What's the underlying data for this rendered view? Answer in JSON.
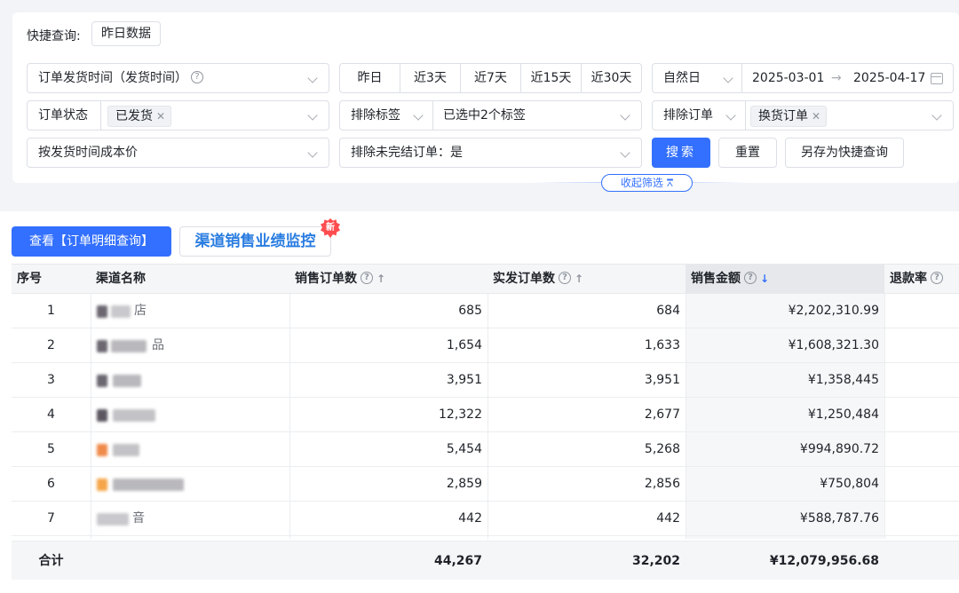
{
  "quick_query": {
    "label": "快捷查询:",
    "tag": "昨日数据"
  },
  "filters": {
    "time_field": "订单发货时间（发货时间）",
    "date_presets": [
      "昨日",
      "近3天",
      "近7天",
      "近15天",
      "近30天"
    ],
    "day_type": "自然日",
    "date_start": "2025-03-01",
    "date_arrow": "→",
    "date_end": "2025-04-17",
    "order_status_label": "订单状态",
    "order_status_chip": "已发货",
    "exclude_tag_label": "排除标签",
    "exclude_tag_value": "已选中2个标签",
    "exclude_order_label": "排除订单",
    "exclude_order_chip": "换货订单",
    "cost_mode": "按发货时间成本价",
    "exclude_unfinished": "排除未完结订单：是"
  },
  "actions": {
    "search": "搜索",
    "reset": "重置",
    "save_quick": "另存为快捷查询",
    "collapse": "收起筛选"
  },
  "tabs": {
    "detail": "查看【订单明细查询】",
    "channel": "渠道销售业绩监控",
    "new_badge": "新"
  },
  "table": {
    "headers": [
      "序号",
      "渠道名称",
      "销售订单数",
      "实发订单数",
      "销售金额",
      "退款率"
    ],
    "rows": [
      {
        "idx": "1",
        "name": "店",
        "sales_orders": "685",
        "shipped_orders": "684",
        "amount": "¥2,202,310.99"
      },
      {
        "idx": "2",
        "name": "品",
        "sales_orders": "1,654",
        "shipped_orders": "1,633",
        "amount": "¥1,608,321.30"
      },
      {
        "idx": "3",
        "name": "",
        "sales_orders": "3,951",
        "shipped_orders": "3,951",
        "amount": "¥1,358,445"
      },
      {
        "idx": "4",
        "name": "",
        "sales_orders": "12,322",
        "shipped_orders": "2,677",
        "amount": "¥1,250,484"
      },
      {
        "idx": "5",
        "name": "",
        "sales_orders": "5,454",
        "shipped_orders": "5,268",
        "amount": "¥994,890.72"
      },
      {
        "idx": "6",
        "name": "",
        "sales_orders": "2,859",
        "shipped_orders": "2,856",
        "amount": "¥750,804"
      },
      {
        "idx": "7",
        "name": "音",
        "sales_orders": "442",
        "shipped_orders": "442",
        "amount": "¥588,787.76"
      }
    ],
    "totals": {
      "label": "合计",
      "sales_orders": "44,267",
      "shipped_orders": "32,202",
      "amount": "¥12,079,956.68"
    }
  },
  "colors": {
    "primary": "#3370ff",
    "channel_text": "#2a7de1",
    "badge": "#ff4d4f"
  }
}
